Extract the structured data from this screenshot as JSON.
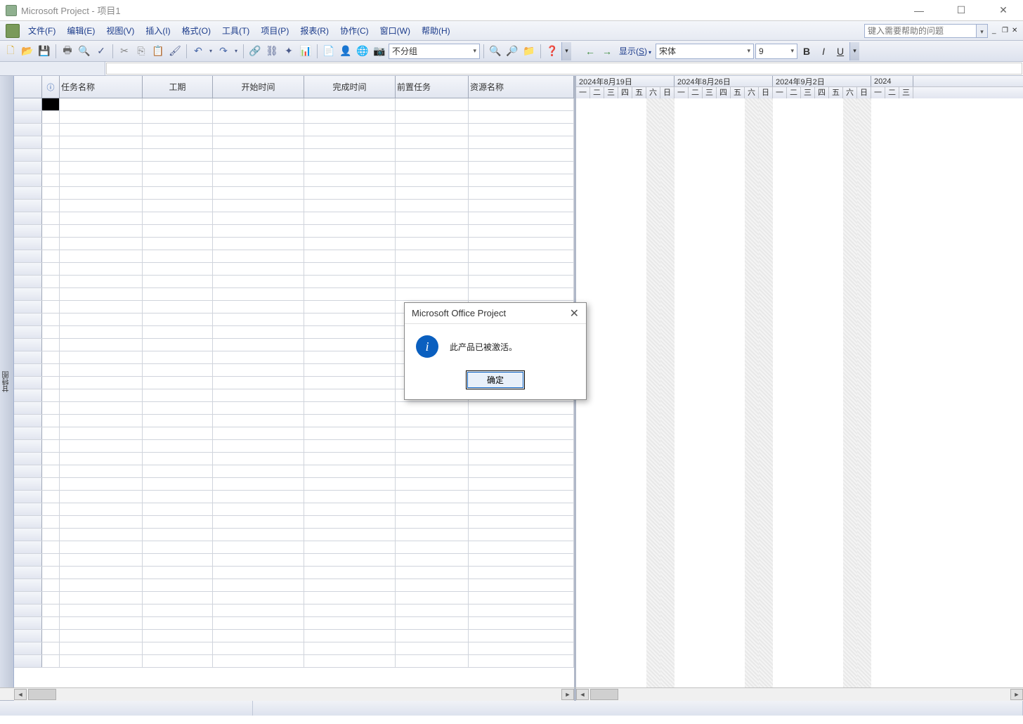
{
  "title": "Microsoft Project - 项目1",
  "menus": {
    "file": "文件(F)",
    "edit": "编辑(E)",
    "view": "视图(V)",
    "insert": "插入(I)",
    "format": "格式(O)",
    "tools": "工具(T)",
    "project": "项目(P)",
    "report": "报表(R)",
    "collab": "协作(C)",
    "window": "窗口(W)",
    "help": "帮助(H)"
  },
  "help_placeholder": "键入需要帮助的问题",
  "toolbar": {
    "group_combo": "不分组",
    "show_label_pre": "显示(",
    "show_label_u": "S",
    "show_label_post": ")",
    "font_combo": "宋体",
    "size_combo": "9",
    "bold": "B",
    "italic": "I",
    "underline": "U"
  },
  "columns": {
    "info": "ⓘ",
    "name": "任务名称",
    "duration": "工期",
    "start": "开始时间",
    "finish": "完成时间",
    "predecessors": "前置任务",
    "resources": "资源名称"
  },
  "timeline": {
    "weeks": [
      "2024年8月19日",
      "2024年8月26日",
      "2024年9月2日",
      "2024"
    ],
    "days": [
      "一",
      "二",
      "三",
      "四",
      "五",
      "六",
      "日"
    ]
  },
  "viewbar_label": "甘特图",
  "dialog": {
    "title": "Microsoft Office Project",
    "message": "此产品已被激活。",
    "ok": "确定"
  }
}
